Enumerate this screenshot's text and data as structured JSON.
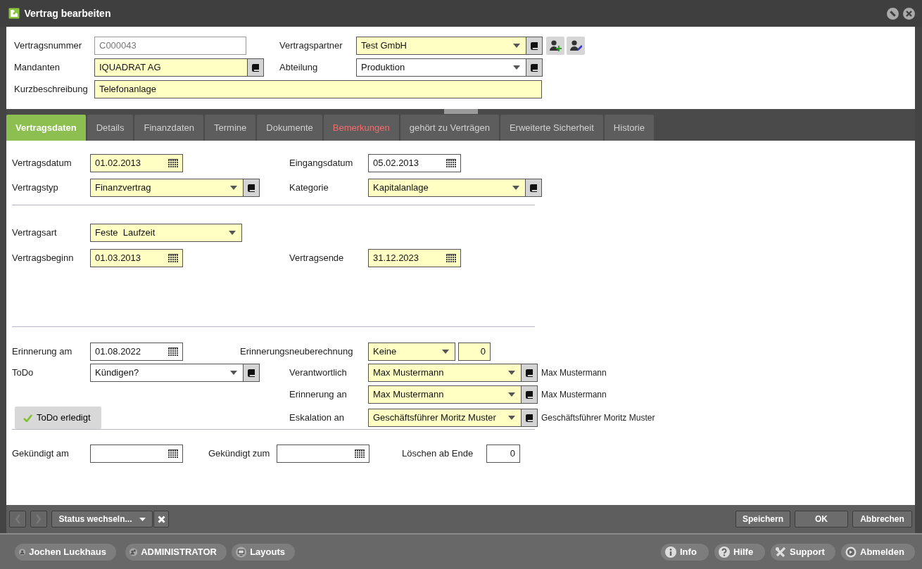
{
  "window": {
    "title": "Vertrag bearbeiten"
  },
  "header": {
    "rows": [
      {
        "fields": [
          {
            "label": "Vertragsnummer",
            "kind": "text",
            "value": "C000043",
            "highlighted": false,
            "readonly": true
          },
          {
            "label": "Vertragspartner",
            "kind": "combo",
            "value": "Test GmbH",
            "highlighted": true,
            "readonly": false,
            "person_buttons": true
          }
        ]
      },
      {
        "fields": [
          {
            "label": "Mandanten",
            "kind": "lookup",
            "value": "IQUADRAT AG",
            "highlighted": true,
            "readonly": false
          },
          {
            "label": "Abteilung",
            "kind": "combo",
            "value": "Produktion",
            "highlighted": false,
            "readonly": false
          }
        ]
      },
      {
        "fields": [
          {
            "label": "Kurzbeschreibung",
            "kind": "text",
            "value": "Telefonanlage",
            "highlighted": true,
            "readonly": false
          }
        ]
      }
    ]
  },
  "tabs": [
    {
      "label": "Vertragsdaten",
      "selected": true,
      "highlighted": false
    },
    {
      "label": "Details",
      "selected": false,
      "highlighted": false
    },
    {
      "label": "Finanzdaten",
      "selected": false,
      "highlighted": false
    },
    {
      "label": "Termine",
      "selected": false,
      "highlighted": false
    },
    {
      "label": "Dokumente",
      "selected": false,
      "highlighted": false
    },
    {
      "label": "Bemerkungen",
      "selected": false,
      "highlighted": true
    },
    {
      "label": "gehört zu Verträgen",
      "selected": false,
      "highlighted": false
    },
    {
      "label": "Erweiterte Sicherheit",
      "selected": false,
      "highlighted": false
    },
    {
      "label": "Historie",
      "selected": false,
      "highlighted": false
    }
  ],
  "sections": [
    {
      "rows": [
        {
          "fields": [
            {
              "label": "Vertragsdatum",
              "kind": "date",
              "value": "01.02.2013",
              "highlighted": true
            },
            {
              "label": "Eingangsdatum",
              "kind": "date",
              "value": "05.02.2013",
              "highlighted": false
            }
          ]
        },
        {
          "fields": [
            {
              "label": "Vertragstyp",
              "kind": "combo",
              "value": "Finanzvertrag",
              "highlighted": true
            },
            {
              "label": "Kategorie",
              "kind": "combo",
              "value": "Kapitalanlage",
              "highlighted": true
            }
          ]
        }
      ]
    },
    {
      "rows": [
        {
          "fields": [
            {
              "label": "Vertragsart",
              "kind": "select",
              "value": "Feste  Laufzeit",
              "highlighted": true
            }
          ]
        },
        {
          "fields": [
            {
              "label": "Vertragsbeginn",
              "kind": "date",
              "value": "01.03.2013",
              "highlighted": true
            },
            {
              "label": "Vertragsende",
              "kind": "date",
              "value": "31.12.2023",
              "highlighted": true
            }
          ]
        }
      ]
    },
    {
      "rows": [
        {
          "fields": [
            {
              "label": "Erinnerung am",
              "kind": "date",
              "value": "01.08.2022",
              "highlighted": false
            },
            {
              "label": "Erinnerungsneuberechnung",
              "kind": "select",
              "value": "Keine",
              "highlighted": true
            },
            {
              "kind": "number",
              "value": "0",
              "highlighted": true
            }
          ]
        },
        {
          "fields": [
            {
              "label": "ToDo",
              "kind": "combo",
              "value": "Kündigen?",
              "highlighted": false
            },
            {
              "label": "Verantwortlich",
              "kind": "combo",
              "value": "Max Mustermann",
              "highlighted": true,
              "note": "Max Mustermann"
            }
          ]
        },
        {
          "fields": [
            {
              "label": "Erinnerung an",
              "kind": "combo",
              "value": "Max Mustermann",
              "highlighted": true,
              "note": "Max Mustermann"
            }
          ]
        },
        {
          "fields": [
            {
              "label": "ToDo erledigt",
              "kind": "button"
            },
            {
              "label": "Eskalation an",
              "kind": "combo",
              "value": "Geschäftsführer Moritz Muster",
              "highlighted": true,
              "note": "Geschäftsführer Moritz Muster"
            }
          ]
        }
      ]
    },
    {
      "rows": [
        {
          "fields": [
            {
              "label": "Gekündigt am",
              "kind": "date",
              "highlighted": false
            },
            {
              "label": "Gekündigt zum",
              "kind": "date",
              "highlighted": false
            },
            {
              "label": "Löschen ab Ende",
              "kind": "number",
              "value": "0",
              "highlighted": false
            }
          ]
        }
      ]
    }
  ],
  "toolbar": {
    "nav": [
      {
        "kind": "prev",
        "disabled": true
      },
      {
        "kind": "next",
        "disabled": true
      }
    ],
    "status_button": "Status wechseln...",
    "buttons": [
      "Speichern",
      "OK",
      "Abbrechen"
    ]
  },
  "taskbar": {
    "left": [
      {
        "kind": "user",
        "label": "Jochen Luckhaus"
      },
      {
        "kind": "role",
        "label": "ADMINISTRATOR"
      },
      {
        "kind": "layouts",
        "label": "Layouts"
      }
    ],
    "right": [
      {
        "kind": "info",
        "label": "Info"
      },
      {
        "kind": "help",
        "label": "Hilfe"
      },
      {
        "kind": "support",
        "label": "Support"
      },
      {
        "kind": "logout",
        "label": "Abmelden"
      }
    ]
  }
}
